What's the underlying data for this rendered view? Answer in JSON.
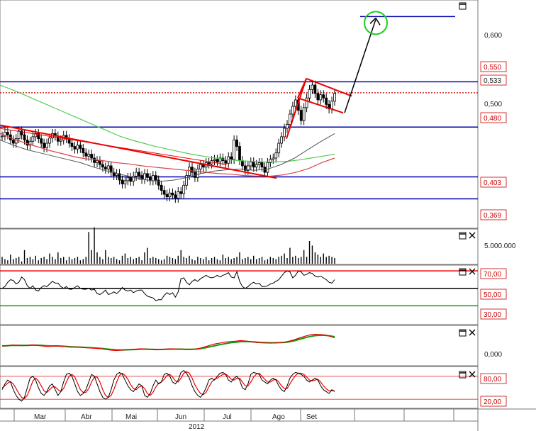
{
  "chart_data": {
    "type": "candlestick",
    "x": {
      "months": [
        "Mar",
        "Abr",
        "Mai",
        "Jun",
        "Jul",
        "Ago",
        "Set"
      ],
      "year": "2012"
    },
    "price_panel": {
      "axis_labels": [
        "0,600",
        "0,500"
      ],
      "ylim": [
        0.33,
        0.67
      ],
      "levels": [
        {
          "value": 0.55,
          "label": "0,550",
          "style": "blue-line"
        },
        {
          "value": 0.533,
          "label": "0,533",
          "style": "red-dotted"
        },
        {
          "value": 0.48,
          "label": "0,480",
          "style": "blue-line"
        },
        {
          "value": 0.403,
          "label": "0,403",
          "style": "blue-line"
        },
        {
          "value": 0.369,
          "label": "0,369",
          "style": "blue-line"
        }
      ],
      "target_level": 0.651,
      "close": [
        0.466,
        0.472,
        0.468,
        0.46,
        0.455,
        0.462,
        0.474,
        0.468,
        0.46,
        0.452,
        0.458,
        0.465,
        0.47,
        0.462,
        0.455,
        0.448,
        0.455,
        0.463,
        0.47,
        0.466,
        0.458,
        0.46,
        0.467,
        0.462,
        0.455,
        0.45,
        0.446,
        0.452,
        0.447,
        0.44,
        0.435,
        0.438,
        0.432,
        0.425,
        0.428,
        0.422,
        0.418,
        0.415,
        0.42,
        0.41,
        0.405,
        0.408,
        0.398,
        0.392,
        0.397,
        0.402,
        0.396,
        0.404,
        0.41,
        0.405,
        0.399,
        0.408,
        0.402,
        0.397,
        0.405,
        0.398,
        0.39,
        0.382,
        0.376,
        0.372,
        0.378,
        0.375,
        0.37,
        0.38,
        0.377,
        0.39,
        0.405,
        0.418,
        0.41,
        0.402,
        0.415,
        0.422,
        0.418,
        0.425,
        0.423,
        0.428,
        0.43,
        0.426,
        0.432,
        0.428,
        0.424,
        0.434,
        0.43,
        0.46,
        0.45,
        0.428,
        0.42,
        0.413,
        0.42,
        0.426,
        0.418,
        0.422,
        0.425,
        0.418,
        0.41,
        0.425,
        0.43,
        0.432,
        0.44,
        0.455,
        0.465,
        0.478,
        0.484,
        0.5,
        0.512,
        0.522,
        0.506,
        0.49,
        0.51,
        0.525,
        0.538,
        0.545,
        0.532,
        0.522,
        0.53,
        0.525,
        0.515,
        0.508,
        0.52,
        0.532
      ],
      "ma_green": [
        0.545,
        0.538,
        0.53,
        0.522,
        0.514,
        0.506,
        0.498,
        0.49,
        0.482,
        0.474,
        0.466,
        0.46,
        0.455,
        0.45,
        0.446,
        0.442,
        0.438,
        0.435,
        0.432,
        0.43,
        0.428,
        0.427,
        0.426,
        0.426,
        0.427,
        0.429,
        0.432,
        0.435,
        0.438
      ],
      "ma_red": [
        0.47,
        0.462,
        0.455,
        0.449,
        0.443,
        0.438,
        0.433,
        0.43,
        0.428,
        0.425,
        0.423,
        0.42,
        0.418,
        0.416,
        0.414,
        0.412,
        0.41,
        0.408,
        0.407,
        0.405,
        0.404,
        0.404,
        0.406,
        0.41,
        0.416,
        0.425,
        0.432
      ],
      "ma_black": [
        0.46,
        0.452,
        0.445,
        0.44,
        0.435,
        0.43,
        0.425,
        0.418,
        0.412,
        0.407,
        0.402,
        0.398,
        0.396,
        0.398,
        0.402,
        0.408,
        0.412,
        0.414,
        0.415,
        0.413,
        0.415,
        0.422,
        0.432,
        0.445,
        0.458,
        0.47
      ]
    },
    "volume_panel": {
      "axis_labels": [
        "5.000.000"
      ],
      "values": [
        0.3,
        0.2,
        0.15,
        0.4,
        0.2,
        0.25,
        0.3,
        0.1,
        0.6,
        0.25,
        0.3,
        0.2,
        0.35,
        0.15,
        0.25,
        0.3,
        0.2,
        0.45,
        0.3,
        0.2,
        0.5,
        0.25,
        0.3,
        0.15,
        0.3,
        0.2,
        0.25,
        0.3,
        0.15,
        0.2,
        0.3,
        1.4,
        0.6,
        1.6,
        0.5,
        0.3,
        0.2,
        0.6,
        0.3,
        0.25,
        0.3,
        0.2,
        0.15,
        0.35,
        0.45,
        0.25,
        0.3,
        0.2,
        0.25,
        0.3,
        0.15,
        0.5,
        0.7,
        0.25,
        0.3,
        0.25,
        0.2,
        0.15,
        0.2,
        0.35,
        0.3,
        0.25,
        0.2,
        0.35,
        0.6,
        0.3,
        0.25,
        0.35,
        0.2,
        0.15,
        0.3,
        0.25,
        0.2,
        0.3,
        0.15,
        0.25,
        0.3,
        0.2,
        0.15,
        0.4,
        0.25,
        0.3,
        0.2,
        0.25,
        0.3,
        0.5,
        0.2,
        0.25,
        0.3,
        0.2,
        0.35,
        0.2,
        0.25,
        0.3,
        0.15,
        0.2,
        0.3,
        0.25,
        0.2,
        0.3,
        0.35,
        0.45,
        0.25,
        0.7,
        0.3,
        0.35,
        0.25,
        0.3,
        0.6,
        0.3,
        1.0,
        0.8,
        0.5,
        0.4,
        0.3,
        0.45,
        0.3,
        0.35,
        0.3,
        0.25
      ]
    },
    "rsi_panel": {
      "levels": [
        {
          "value": 70,
          "label": "70,00"
        },
        {
          "value": 50,
          "label": "50,00"
        },
        {
          "value": 30,
          "label": "30,00"
        }
      ],
      "ylim": [
        10,
        75
      ],
      "values": [
        50,
        52,
        57,
        60,
        59,
        55,
        57,
        63,
        60,
        53,
        50,
        53,
        48,
        47,
        51,
        53,
        52,
        55,
        58,
        56,
        56,
        52,
        50,
        52,
        49,
        49,
        51,
        53,
        50,
        49,
        49,
        50,
        48,
        49,
        44,
        43,
        45,
        48,
        43,
        44,
        46,
        44,
        47,
        51,
        48,
        47,
        48,
        45,
        47,
        48,
        48,
        44,
        41,
        40,
        39,
        36,
        37,
        37,
        42,
        45,
        43,
        45,
        40,
        46,
        61,
        62,
        57,
        54,
        58,
        60,
        58,
        61,
        63,
        65,
        63,
        62,
        63,
        65,
        63,
        65,
        66,
        68,
        63,
        62,
        69,
        58,
        52,
        50,
        52,
        55,
        57,
        55,
        56,
        52,
        52,
        53,
        55,
        56,
        58,
        60,
        64,
        68,
        70,
        69,
        62,
        65,
        70,
        69,
        65,
        66,
        68,
        67,
        64,
        63,
        64,
        62,
        60,
        57,
        56,
        60
      ]
    },
    "macd_panel": {
      "axis_labels": [
        "0,000"
      ],
      "ylim": [
        -1,
        1
      ],
      "macd": [
        0.0,
        0.02,
        0.05,
        0.04,
        0.02,
        0.03,
        0.06,
        0.04,
        0.0,
        -0.03,
        -0.02,
        0.0,
        -0.02,
        -0.05,
        -0.07,
        -0.06,
        -0.08,
        -0.1,
        -0.12,
        -0.14,
        -0.16,
        -0.2,
        -0.24,
        -0.26,
        -0.24,
        -0.22,
        -0.2,
        -0.18,
        -0.16,
        -0.18,
        -0.2,
        -0.22,
        -0.2,
        -0.18,
        -0.16,
        -0.17,
        -0.18,
        -0.2,
        -0.2,
        -0.18,
        -0.12,
        -0.04,
        0.05,
        0.12,
        0.17,
        0.22,
        0.25,
        0.27,
        0.3,
        0.28,
        0.25,
        0.2,
        0.18,
        0.17,
        0.16,
        0.17,
        0.19,
        0.22,
        0.28,
        0.36,
        0.46,
        0.55,
        0.62,
        0.66,
        0.65,
        0.62,
        0.55,
        0.46
      ],
      "signal": [
        0.0,
        0.01,
        0.03,
        0.03,
        0.03,
        0.03,
        0.04,
        0.04,
        0.03,
        0.01,
        0.0,
        0.0,
        -0.01,
        -0.03,
        -0.05,
        -0.06,
        -0.07,
        -0.09,
        -0.1,
        -0.12,
        -0.14,
        -0.17,
        -0.2,
        -0.22,
        -0.23,
        -0.22,
        -0.21,
        -0.2,
        -0.18,
        -0.18,
        -0.19,
        -0.2,
        -0.2,
        -0.19,
        -0.18,
        -0.18,
        -0.18,
        -0.19,
        -0.19,
        -0.18,
        -0.15,
        -0.1,
        -0.04,
        0.02,
        0.08,
        0.13,
        0.18,
        0.21,
        0.24,
        0.25,
        0.24,
        0.22,
        0.2,
        0.19,
        0.18,
        0.18,
        0.19,
        0.2,
        0.24,
        0.3,
        0.38,
        0.46,
        0.53,
        0.58,
        0.6,
        0.6,
        0.57,
        0.52
      ]
    },
    "stoch_panel": {
      "levels": [
        {
          "value": 80,
          "label": "80,00"
        },
        {
          "value": 20,
          "label": "20,00"
        }
      ],
      "ylim": [
        0,
        100
      ],
      "k": [
        45,
        60,
        70,
        65,
        45,
        30,
        20,
        15,
        25,
        50,
        75,
        80,
        70,
        50,
        35,
        30,
        40,
        55,
        60,
        45,
        30,
        40,
        65,
        85,
        88,
        80,
        60,
        40,
        30,
        35,
        45,
        65,
        85,
        80,
        60,
        40,
        25,
        20,
        25,
        45,
        70,
        85,
        90,
        85,
        70,
        55,
        45,
        40,
        50,
        60,
        55,
        30,
        25,
        35,
        55,
        70,
        60,
        65,
        85,
        88,
        80,
        65,
        60,
        70,
        90,
        95,
        88,
        75,
        55,
        40,
        30,
        25,
        35,
        50,
        70,
        75,
        70,
        80,
        88,
        90,
        85,
        70,
        65,
        75,
        80,
        70,
        50,
        45,
        60,
        85,
        90,
        88,
        85,
        70,
        65,
        60,
        70,
        75,
        70,
        55,
        45,
        40,
        55,
        75,
        85,
        90,
        88,
        85,
        80,
        70,
        65,
        70,
        75,
        70,
        55,
        45,
        40,
        35,
        45,
        40
      ],
      "d": [
        50,
        55,
        62,
        66,
        60,
        48,
        35,
        25,
        22,
        30,
        48,
        68,
        75,
        68,
        55,
        42,
        38,
        45,
        52,
        52,
        45,
        40,
        48,
        65,
        80,
        85,
        78,
        62,
        45,
        38,
        38,
        48,
        65,
        78,
        78,
        65,
        45,
        30,
        25,
        30,
        45,
        65,
        82,
        88,
        82,
        72,
        58,
        48,
        45,
        52,
        55,
        48,
        35,
        30,
        38,
        52,
        62,
        65,
        72,
        82,
        85,
        78,
        68,
        65,
        75,
        88,
        92,
        88,
        75,
        58,
        45,
        35,
        32,
        38,
        52,
        65,
        72,
        75,
        80,
        85,
        86,
        80,
        72,
        70,
        75,
        75,
        65,
        55,
        55,
        65,
        78,
        86,
        88,
        80,
        72,
        65,
        65,
        70,
        72,
        65,
        55,
        48,
        48,
        60,
        72,
        82,
        88,
        88,
        85,
        78,
        70,
        68,
        70,
        72,
        65,
        55,
        47,
        42,
        42,
        42
      ]
    }
  }
}
